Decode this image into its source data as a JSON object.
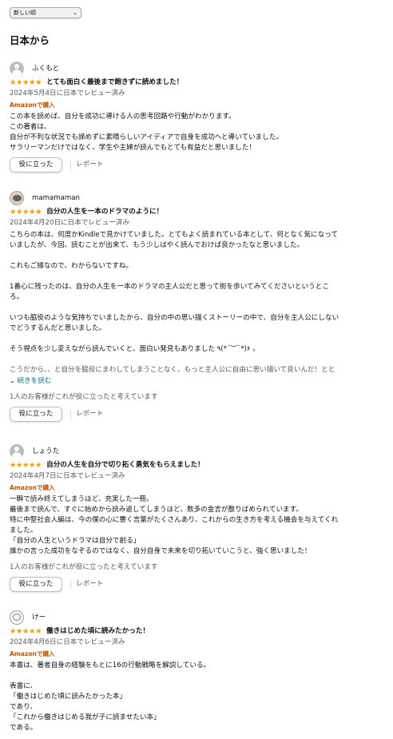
{
  "sort": {
    "selected": "新しい順"
  },
  "section_title": "日本から",
  "colors": {
    "stars": "#ff9900",
    "verified": "#c45500",
    "link": "#007185"
  },
  "reviews": [
    {
      "author": "ふくもと",
      "stars": "★★★★★",
      "title": "とても面白く最後まで飽きずに読めました！",
      "date": "2024年5月4日に日本でレビュー済み",
      "verified": "Amazonで購入",
      "lines": [
        "この本を読めば、自分を成功に導ける人の思考回路や行動がわかります。",
        "この著者は、",
        "自分が不利な状況でも諦めずに素晴らしいアイディアで自身を成功へと導いていました。",
        "サラリーマンだけではなく、学生や主婦が読んでもとても有益だと思いました！"
      ],
      "helpful_label": "役に立った",
      "report_label": "レポート"
    },
    {
      "author": "mamamaman",
      "stars": "★★★★★",
      "title": "自分の人生を一本のドラマのように！",
      "date": "2024年4月20日に日本でレビュー済み",
      "lines": [
        "こちらの本は、何度かKindleで見かけていました。とてもよく読まれている本として、何となく気になって",
        "いましたが、今回、読むことが出来て、もう少しはやく読んでおけば良かったなと思いました。",
        "",
        "これもご縁なので、わからないですね。",
        "",
        "1番心に残ったのは、自分の人生を一本のドラマの主人公だと思って街を歩いてみてくださいというとこ",
        "ろ。",
        "",
        "いつも脇役のような気持ちでいましたから、自分の中の思い描くストーリーの中で、自分を主人公にしない",
        "でどうするんだと思いました。",
        "",
        "そう視点を少し変えながら読んでいくと、面白い発見もありました ٩(*´︶`*)۶ 。"
      ],
      "fade_line": "こうだから、、と自分を脇役にまわしてしまうことなく、もっと主人公に自由に思い描いて良いんだ！とと",
      "read_more": "続きを読む",
      "helpful_count": "1人のお客様がこれが役に立ったと考えています",
      "helpful_label": "役に立った",
      "report_label": "レポート"
    },
    {
      "author": "しょうた",
      "stars": "★★★★★",
      "title": "自分の人生を自分で切り拓く勇気をもらえました！",
      "date": "2024年4月7日に日本でレビュー済み",
      "verified": "Amazonで購入",
      "lines": [
        "一瞬で読み終えてしまうほど、充実した一冊。",
        "最後まで読んで、すぐに始めから読み返してしまうほど、数多の金言が散りばめられています。",
        "特に中堅社会人編は、今の僕の心に響く言葉がたくさんあり、これからの生き方を考える機会を与えてくれ",
        "ました。",
        "「自分の人生というドラマは自分で創る」",
        "誰かの言った成功をなぞるのではなく、自分自身で未来を切り拓いていこうと、強く思いました！"
      ],
      "helpful_count": "1人のお客様がこれが役に立ったと考えています",
      "helpful_label": "役に立った",
      "report_label": "レポート"
    },
    {
      "author": "けー",
      "stars": "★★★★★",
      "title": "働きはじめた頃に読みたかった！",
      "date": "2024年4月6日に日本でレビュー済み",
      "verified": "Amazonで購入",
      "lines": [
        "本書は、著者自身の経験をもとに16の行動戦略を解説している。",
        "",
        "表書に、",
        "「働きはじめた頃に読みたかった本」",
        "であり、",
        "「これから働きはじめる我が子に読ませたい本」",
        "である。"
      ]
    }
  ]
}
